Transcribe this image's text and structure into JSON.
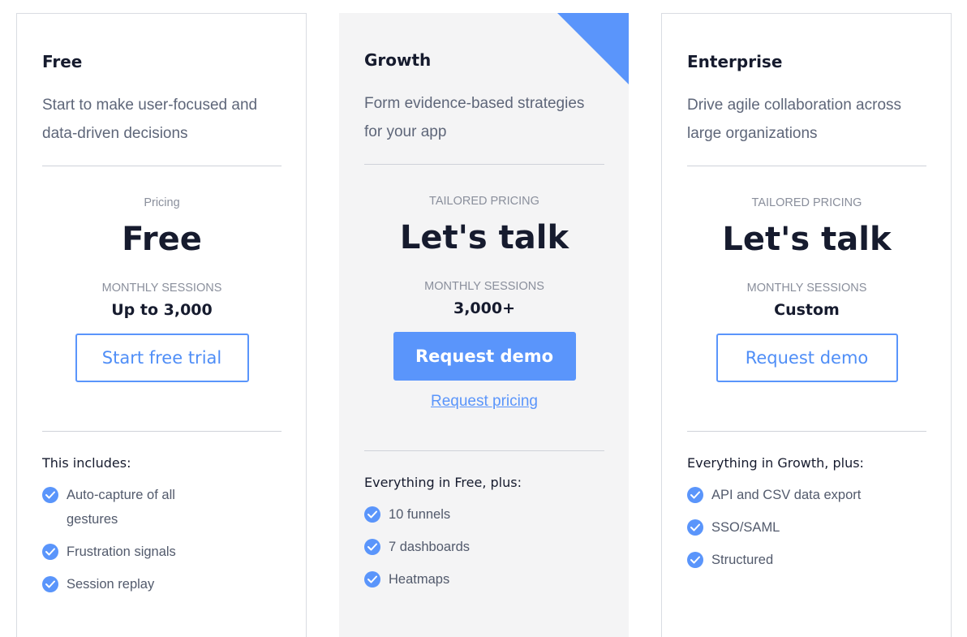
{
  "plans": [
    {
      "name": "Free",
      "description": "Start to make user-focused and data-driven decisions",
      "pricing_label": "Pricing",
      "price": "Free",
      "sessions_label": "MONTHLY SESSIONS",
      "sessions_value": "Up to 3,000",
      "button_label": "Start free trial",
      "includes_title": "This includes:",
      "features": [
        "Auto-capture of all gestures",
        "Frustration signals",
        "Session replay"
      ]
    },
    {
      "name": "Growth",
      "description": "Form evidence-based strategies for your app",
      "pricing_label": "TAILORED PRICING",
      "price": "Let's talk",
      "sessions_label": "MONTHLY SESSIONS",
      "sessions_value": "3,000+",
      "button_label": "Request demo",
      "link_label": "Request pricing",
      "includes_title": "Everything in Free, plus:",
      "features": [
        "10 funnels",
        "7 dashboards",
        "Heatmaps"
      ]
    },
    {
      "name": "Enterprise",
      "description": "Drive agile collaboration across large organizations",
      "pricing_label": "TAILORED PRICING",
      "price": "Let's talk",
      "sessions_label": "MONTHLY SESSIONS",
      "sessions_value": "Custom",
      "button_label": "Request demo",
      "includes_title": "Everything in Growth, plus:",
      "features": [
        "API and CSV data export",
        "SSO/SAML",
        "Structured"
      ]
    }
  ],
  "icons": {
    "feature_check": "check-circle-icon",
    "featured_corner": "corner-ribbon"
  },
  "colors": {
    "accent": "#5a95fb",
    "featured_background": "#f4f4f5",
    "heading": "#161b2e",
    "muted": "#8a8f9c",
    "body": "#5e6679",
    "border": "#d9dce2"
  }
}
